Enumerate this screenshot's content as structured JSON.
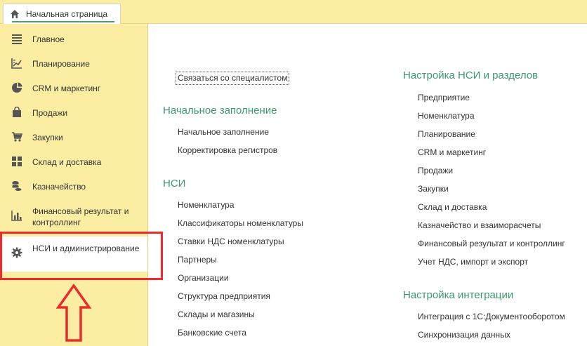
{
  "top_tab": {
    "label": "Начальная страница"
  },
  "sidebar": {
    "items": [
      {
        "label": "Главное",
        "icon": "menu-lines-icon"
      },
      {
        "label": "Планирование",
        "icon": "planning-chart-icon"
      },
      {
        "label": "CRM и маркетинг",
        "icon": "pie-chart-icon"
      },
      {
        "label": "Продажи",
        "icon": "shopping-bag-icon"
      },
      {
        "label": "Закупки",
        "icon": "cart-icon"
      },
      {
        "label": "Склад и доставка",
        "icon": "grid-blocks-icon"
      },
      {
        "label": "Казначейство",
        "icon": "coins-icon"
      },
      {
        "label": "Финансовый результат и контроллинг",
        "icon": "bar-chart-icon"
      },
      {
        "label": "НСИ и администрирование",
        "icon": "gear-icon"
      }
    ]
  },
  "content": {
    "contact_link": "Связаться со специалистом",
    "left_sections": [
      {
        "heading": "Начальное заполнение",
        "links": [
          "Начальное заполнение",
          "Корректировка регистров"
        ]
      },
      {
        "heading": "НСИ",
        "links": [
          "Номенклатура",
          "Классификаторы номенклатуры",
          "Ставки НДС номенклатуры",
          "Партнеры",
          "Организации",
          "Структура предприятия",
          "Склады и магазины",
          "Банковские счета"
        ]
      }
    ],
    "right_sections": [
      {
        "heading": "Настройка НСИ и разделов",
        "links": [
          "Предприятие",
          "Номенклатура",
          "Планирование",
          "CRM и маркетинг",
          "Продажи",
          "Закупки",
          "Склад и доставка",
          "Казначейство и взаиморасчеты",
          "Финансовый результат и контроллинг",
          "Учет НДС, импорт и экспорт"
        ]
      },
      {
        "heading": "Настройка интеграции",
        "links": [
          "Интеграция с 1С:Документооборотом",
          "Синхронизация данных"
        ]
      }
    ]
  },
  "colors": {
    "sidebar_bg": "#fbeea3",
    "heading_green": "#3a9a6c",
    "highlight_red": "#ee2a2a"
  }
}
